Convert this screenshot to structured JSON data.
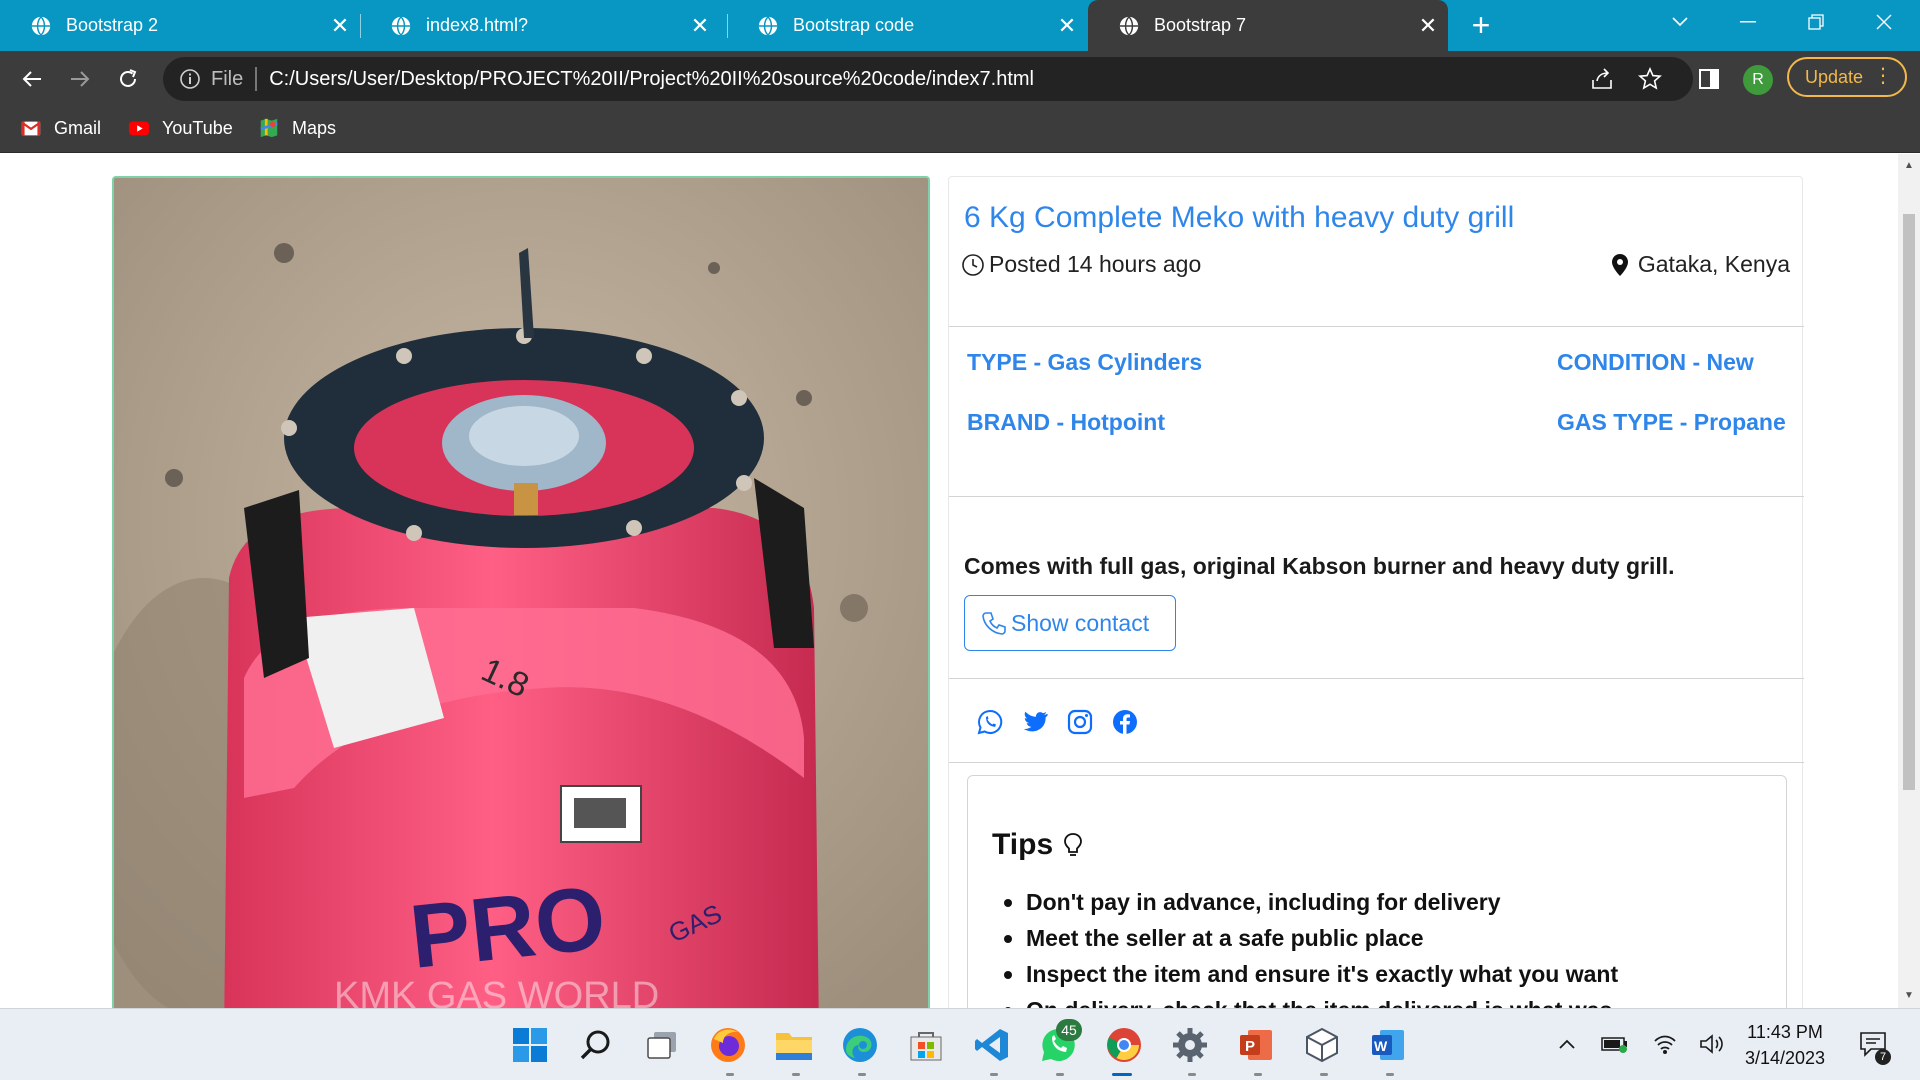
{
  "browser": {
    "tabs": [
      {
        "label": "Bootstrap 2",
        "active": false
      },
      {
        "label": "index8.html?",
        "active": false
      },
      {
        "label": "Bootstrap code",
        "active": false
      },
      {
        "label": "Bootstrap 7",
        "active": true
      }
    ],
    "address": {
      "scheme_label": "File",
      "url": "C:/Users/User/Desktop/PROJECT%20II/Project%20II%20source%20code/index7.html"
    },
    "profile_initial": "R",
    "update_label": "Update",
    "bookmarks": [
      {
        "label": "Gmail",
        "icon": "gmail-icon"
      },
      {
        "label": "YouTube",
        "icon": "youtube-icon"
      },
      {
        "label": "Maps",
        "icon": "maps-icon"
      }
    ]
  },
  "listing": {
    "title": "6 Kg Complete Meko with heavy duty grill",
    "posted": "Posted 14 hours ago",
    "location": "Gataka, Kenya",
    "specs": {
      "type": "TYPE - Gas Cylinders",
      "condition": "CONDITION - New",
      "brand": "BRAND - Hotpoint",
      "gas_type": "GAS TYPE - Propane"
    },
    "description": "Comes with full gas, original Kabson burner and heavy duty grill.",
    "contact_button": "Show contact",
    "share_icons": [
      "whatsapp-icon",
      "twitter-icon",
      "instagram-icon",
      "facebook-icon"
    ],
    "photo": {
      "watermark": "KMK GAS WORLD",
      "brand_text": "PRO",
      "brand_sub": "GAS",
      "cylinder_mark": "1.8"
    }
  },
  "tips": {
    "title": "Tips",
    "items": [
      "Don't pay in advance, including for delivery",
      "Meet the seller at a safe public place",
      "Inspect the item and ensure it's exactly what you want",
      "On delivery, check that the item delivered is what was"
    ]
  },
  "taskbar": {
    "whatsapp_badge": "45",
    "time": "11:43 PM",
    "date": "3/14/2023",
    "notifications": "7"
  },
  "colors": {
    "tab_strip": "#0797c2",
    "chrome_dark": "#3c3c3c",
    "link_blue": "#2f86ea",
    "update_amber": "#f2b84b"
  }
}
